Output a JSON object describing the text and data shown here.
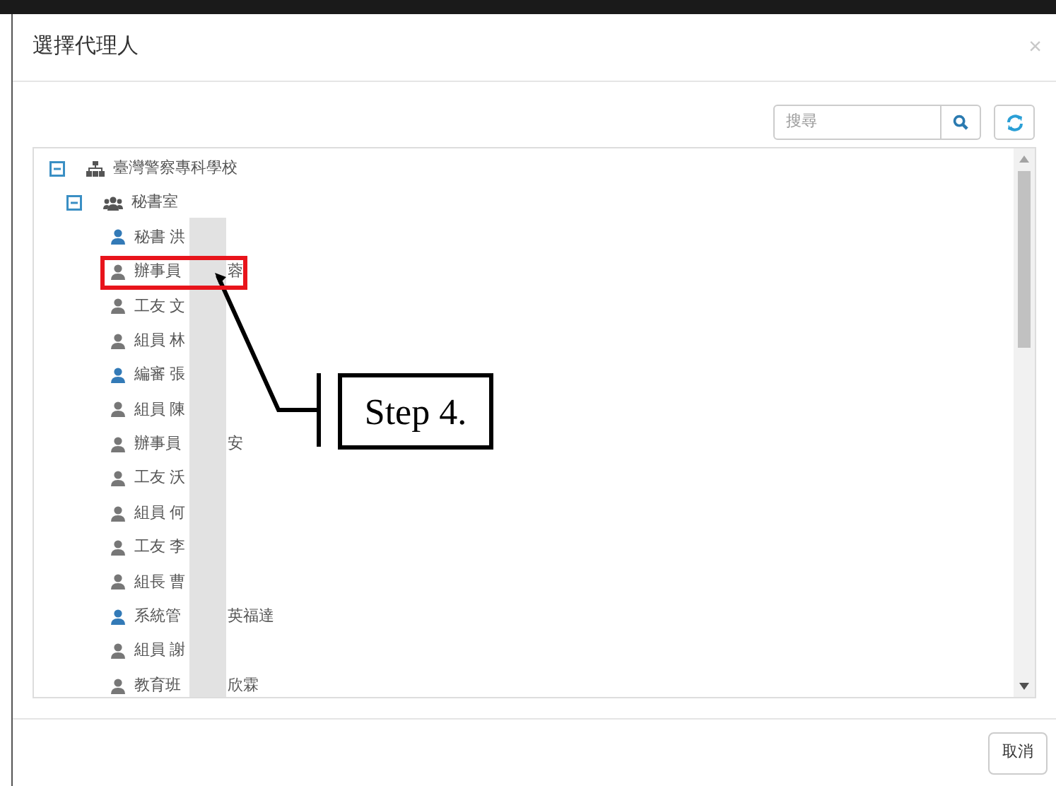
{
  "dialog": {
    "title": "選擇代理人",
    "close": "×"
  },
  "search": {
    "placeholder": "搜尋"
  },
  "tree": {
    "label": "臺灣警察專科學校",
    "expanded": true,
    "children": [
      {
        "label": "秘書室",
        "expanded": true,
        "children": [
          {
            "text": "秘書 洪",
            "color": "#337ab7",
            "highlighted": false
          },
          {
            "text": "辦事員",
            "tail": "蓉",
            "color": "#777777",
            "highlighted": true
          },
          {
            "text": "工友 文",
            "color": "#777777",
            "highlighted": false
          },
          {
            "text": "組員 林",
            "color": "#777777",
            "highlighted": false
          },
          {
            "text": "編審 張",
            "color": "#337ab7",
            "highlighted": false
          },
          {
            "text": "組員 陳",
            "color": "#777777",
            "highlighted": false
          },
          {
            "text": "辦事員",
            "tail": "安",
            "color": "#777777",
            "highlighted": false
          },
          {
            "text": "工友 沃",
            "color": "#777777",
            "highlighted": false
          },
          {
            "text": "組員 何",
            "color": "#777777",
            "highlighted": false
          },
          {
            "text": "工友 李",
            "color": "#777777",
            "highlighted": false
          },
          {
            "text": "組長 曹",
            "color": "#777777",
            "highlighted": false
          },
          {
            "text": "系統管",
            "tail": "英福達",
            "color": "#337ab7",
            "highlighted": false
          },
          {
            "text": "組員 謝",
            "color": "#777777",
            "highlighted": false
          },
          {
            "text": "教育班",
            "tail": "欣霖",
            "color": "#777777",
            "highlighted": false
          }
        ]
      }
    ]
  },
  "callout": {
    "label": "Step 4."
  },
  "buttons": [
    "取消"
  ]
}
